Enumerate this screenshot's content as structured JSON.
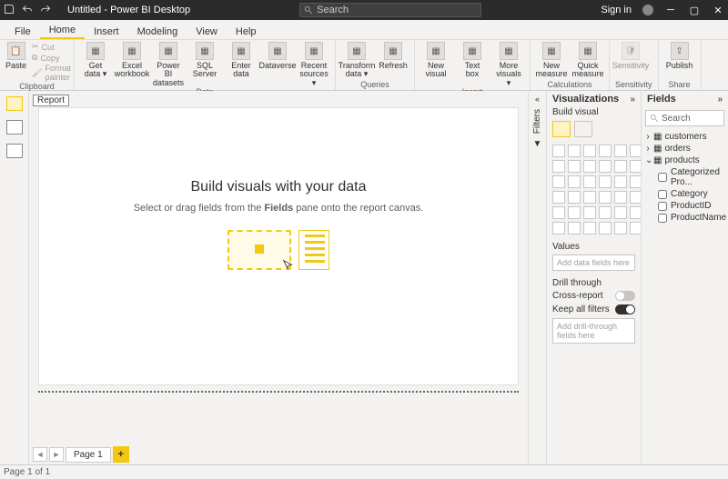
{
  "titlebar": {
    "title": "Untitled - Power BI Desktop",
    "search_placeholder": "Search",
    "signin": "Sign in"
  },
  "tabs": [
    "File",
    "Home",
    "Insert",
    "Modeling",
    "View",
    "Help"
  ],
  "active_tab": "Home",
  "ribbon": {
    "clipboard": {
      "paste": "Paste",
      "cut": "Cut",
      "copy": "Copy",
      "format_painter": "Format painter",
      "group": "Clipboard"
    },
    "data": {
      "items": [
        {
          "label": "Get\ndata",
          "drop": true
        },
        {
          "label": "Excel\nworkbook"
        },
        {
          "label": "Power BI\ndatasets"
        },
        {
          "label": "SQL\nServer"
        },
        {
          "label": "Enter\ndata"
        },
        {
          "label": "Dataverse"
        },
        {
          "label": "Recent\nsources",
          "drop": true
        }
      ],
      "group": "Data"
    },
    "queries": {
      "items": [
        {
          "label": "Transform\ndata",
          "drop": true
        },
        {
          "label": "Refresh"
        }
      ],
      "group": "Queries"
    },
    "insert": {
      "items": [
        {
          "label": "New\nvisual"
        },
        {
          "label": "Text\nbox"
        },
        {
          "label": "More\nvisuals",
          "drop": true
        }
      ],
      "group": "Insert"
    },
    "calc": {
      "items": [
        {
          "label": "New\nmeasure"
        },
        {
          "label": "Quick\nmeasure"
        }
      ],
      "group": "Calculations"
    },
    "sensitivity": {
      "label": "Sensitivity",
      "group": "Sensitivity"
    },
    "share": {
      "label": "Publish",
      "group": "Share"
    }
  },
  "leftrail": {
    "report_label": "Report"
  },
  "canvas": {
    "heading": "Build visuals with your data",
    "sub_pre": "Select or drag fields from the ",
    "sub_bold": "Fields",
    "sub_post": " pane onto the report canvas."
  },
  "pages": {
    "page1": "Page 1",
    "status": "Page 1 of 1"
  },
  "filters_label": "Filters",
  "vis": {
    "title": "Visualizations",
    "build": "Build visual",
    "values": "Values",
    "values_ph": "Add data fields here",
    "drill": "Drill through",
    "cross": "Cross-report",
    "keep": "Keep all filters",
    "drill_ph": "Add drill-through fields here"
  },
  "fields": {
    "title": "Fields",
    "search_ph": "Search",
    "tables": [
      {
        "name": "customers",
        "expanded": false
      },
      {
        "name": "orders",
        "expanded": false
      },
      {
        "name": "products",
        "expanded": true,
        "columns": [
          "Categorized Pro...",
          "Category",
          "ProductID",
          "ProductName"
        ]
      }
    ]
  }
}
